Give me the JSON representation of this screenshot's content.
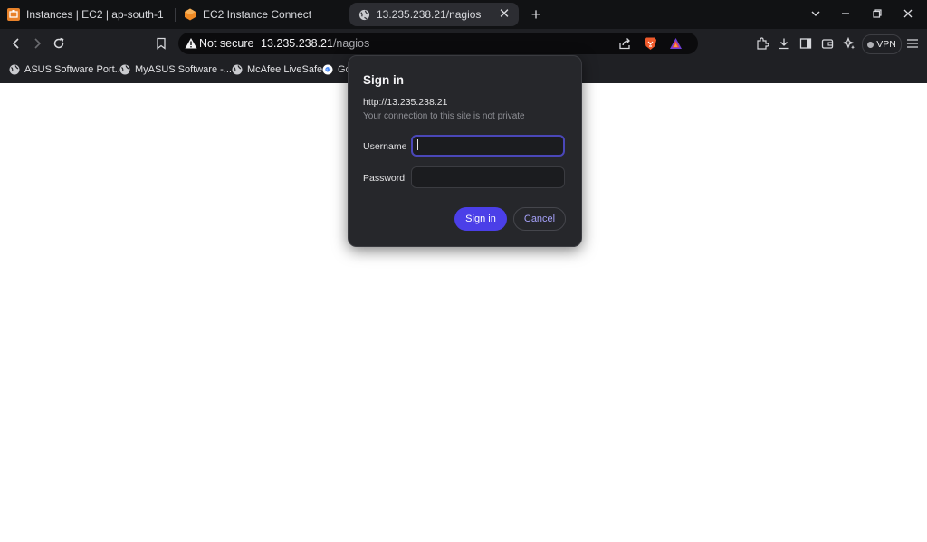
{
  "tabs": [
    {
      "title": "Instances | EC2 | ap-south-1",
      "icon": "aws-console-icon"
    },
    {
      "title": "EC2 Instance Connect",
      "icon": "aws-ec2-icon"
    },
    {
      "title": "13.235.238.21/nagios",
      "icon": "globe-icon",
      "active": true
    }
  ],
  "addressbar": {
    "security_label": "Not secure",
    "url_host": "13.235.238.21",
    "url_path": "/nagios"
  },
  "toolbar": {
    "vpn_label": "VPN"
  },
  "bookmarks": [
    {
      "label": "ASUS Software Port..."
    },
    {
      "label": "MyASUS Software -..."
    },
    {
      "label": "McAfee LiveSafe"
    },
    {
      "label": "Go"
    }
  ],
  "dialog": {
    "title": "Sign in",
    "origin": "http://13.235.238.21",
    "warning": "Your connection to this site is not private",
    "username_label": "Username",
    "username_value": "",
    "password_label": "Password",
    "password_value": "",
    "signin_label": "Sign in",
    "cancel_label": "Cancel"
  },
  "colors": {
    "accent": "#4b3fe8",
    "chrome_bg": "#111214",
    "toolbar_bg": "#1f2024",
    "dialog_bg": "#26272b"
  }
}
